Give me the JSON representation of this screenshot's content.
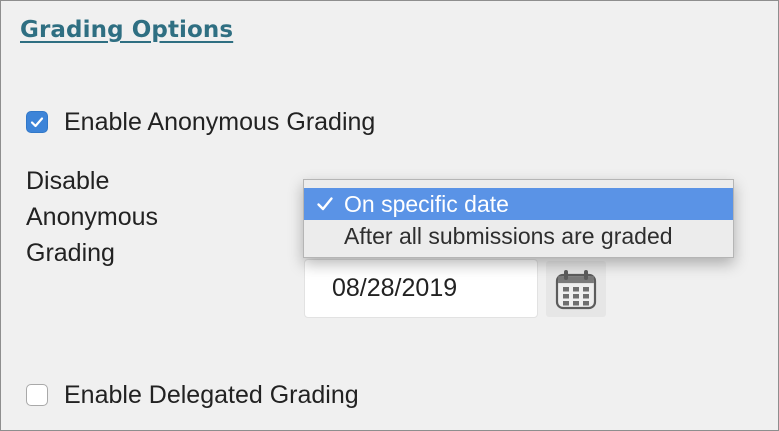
{
  "section": {
    "title": "Grading Options"
  },
  "anonymous_grading": {
    "label": "Enable Anonymous Grading",
    "checked": true
  },
  "disable_anonymous": {
    "label_lines": [
      "Disable",
      "Anonymous",
      "Grading"
    ],
    "options": [
      {
        "label": "On specific date",
        "selected": true
      },
      {
        "label": "After all submissions are graded",
        "selected": false
      }
    ],
    "date_value": "08/28/2019"
  },
  "delegated_grading": {
    "label": "Enable Delegated Grading",
    "checked": false
  },
  "colors": {
    "title": "#2f6f82",
    "checkbox_checked": "#3d84d8",
    "dropdown_highlight": "#5a93e6"
  },
  "icons": {
    "anonymous_checkbox": "checkmark-icon",
    "calendar": "calendar-icon",
    "selected_option": "checkmark-icon"
  }
}
